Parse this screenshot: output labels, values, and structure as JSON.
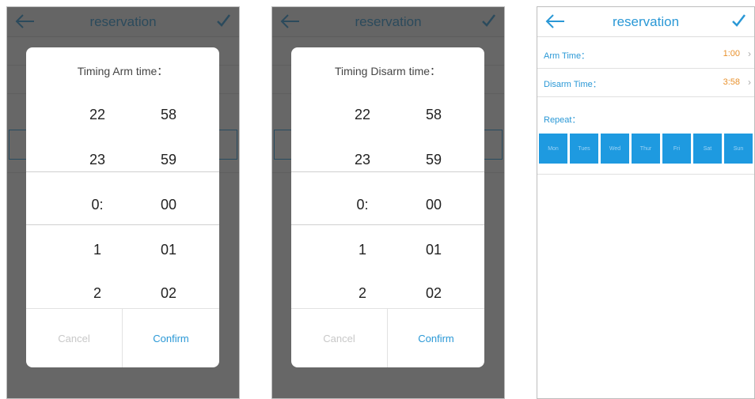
{
  "header": {
    "title": "reservation"
  },
  "screens": [
    {
      "dialog": {
        "title": "Timing Arm time：",
        "hours": [
          "22",
          "23",
          "0:",
          "1",
          "2"
        ],
        "minutes": [
          "58",
          "59",
          "00",
          "01",
          "02"
        ],
        "cancel": "Cancel",
        "confirm": "Confirm"
      }
    },
    {
      "dialog": {
        "title": "Timing Disarm time：",
        "hours": [
          "22",
          "23",
          "0:",
          "1",
          "2"
        ],
        "minutes": [
          "58",
          "59",
          "00",
          "01",
          "02"
        ],
        "cancel": "Cancel",
        "confirm": "Confirm"
      }
    }
  ],
  "settings": {
    "arm_label": "Arm Time：",
    "arm_value": "1:00",
    "disarm_label": "Disarm Time：",
    "disarm_value": "3:58",
    "repeat_label": "Repeat：",
    "days": [
      "Mon",
      "Tues",
      "Wed",
      "Thur",
      "Fri",
      "Sat",
      "Sun"
    ]
  },
  "colors": {
    "accent": "#2a98d6",
    "day_bg": "#1e9ae0",
    "time_value": "#e8912c"
  }
}
